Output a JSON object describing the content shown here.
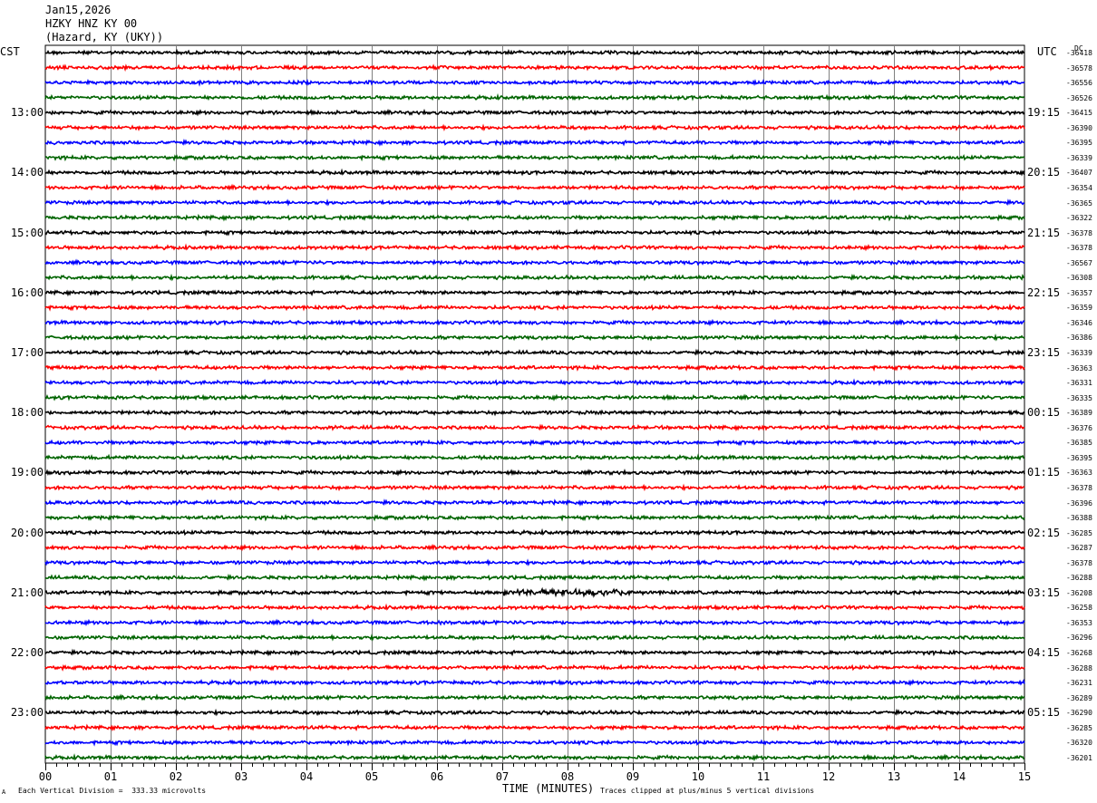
{
  "header": {
    "date": "Jan15,2026",
    "station": "HZKY HNZ KY 00",
    "location": "(Hazard, KY (UKY))"
  },
  "left_timezone": "CST",
  "right_timezone": "UTC",
  "dc_label": "DC",
  "footer": {
    "scale_note": "Each Vertical Division =  333.33 microvolts",
    "clip_note": "Traces clipped at plus/minus 5 vertical divisions",
    "corner_mark": "A"
  },
  "colors": {
    "trace_cycle": [
      "#000000",
      "#ff0000",
      "#0000ff",
      "#006400"
    ],
    "grid": "#808080"
  },
  "chart_data": {
    "type": "line",
    "title": "Jan15,2026 HZKY HNZ KY 00 (Hazard, KY (UKY))",
    "xlabel": "TIME (MINUTES)",
    "ylabel": "",
    "xlim": [
      0,
      15
    ],
    "x_ticks": [
      "00",
      "01",
      "02",
      "03",
      "04",
      "05",
      "06",
      "07",
      "08",
      "09",
      "10",
      "11",
      "12",
      "13",
      "14",
      "15"
    ],
    "minutes_per_line": 15,
    "lines_per_hour": 4,
    "hour_labels_local": [
      "13:00",
      "14:00",
      "15:00",
      "16:00",
      "17:00",
      "18:00",
      "19:00",
      "20:00",
      "21:00",
      "22:00",
      "23:00"
    ],
    "hour_labels_utc": [
      "19:15",
      "20:15",
      "21:15",
      "22:15",
      "23:15",
      "00:15",
      "01:15",
      "02:15",
      "03:15",
      "04:15",
      "05:15"
    ],
    "dc_offsets": [
      "-36418",
      "-36578",
      "-36556",
      "-36526",
      "-36415",
      "-36390",
      "-36395",
      "-36339",
      "-36407",
      "-36354",
      "-36365",
      "-36322",
      "-36378",
      "-36378",
      "-36567",
      "-36308",
      "-36357",
      "-36359",
      "-36346",
      "-36386",
      "-36339",
      "-36363",
      "-36331",
      "-36335",
      "-36389",
      "-36376",
      "-36385",
      "-36395",
      "-36363",
      "-36378",
      "-36396",
      "-36388",
      "-36285",
      "-36287",
      "-36378",
      "-36288",
      "-36208",
      "-36258",
      "-36353",
      "-36296",
      "-36268",
      "-36288",
      "-36231",
      "-36289",
      "-36290",
      "-36285",
      "-36320",
      "-36201"
    ],
    "amplitude_divisions": {
      "typical": 0.3,
      "clip": 5
    },
    "events": [
      {
        "line": 36,
        "start_min": 7.0,
        "end_min": 9.0,
        "amplitude_divisions": 0.6
      }
    ]
  }
}
